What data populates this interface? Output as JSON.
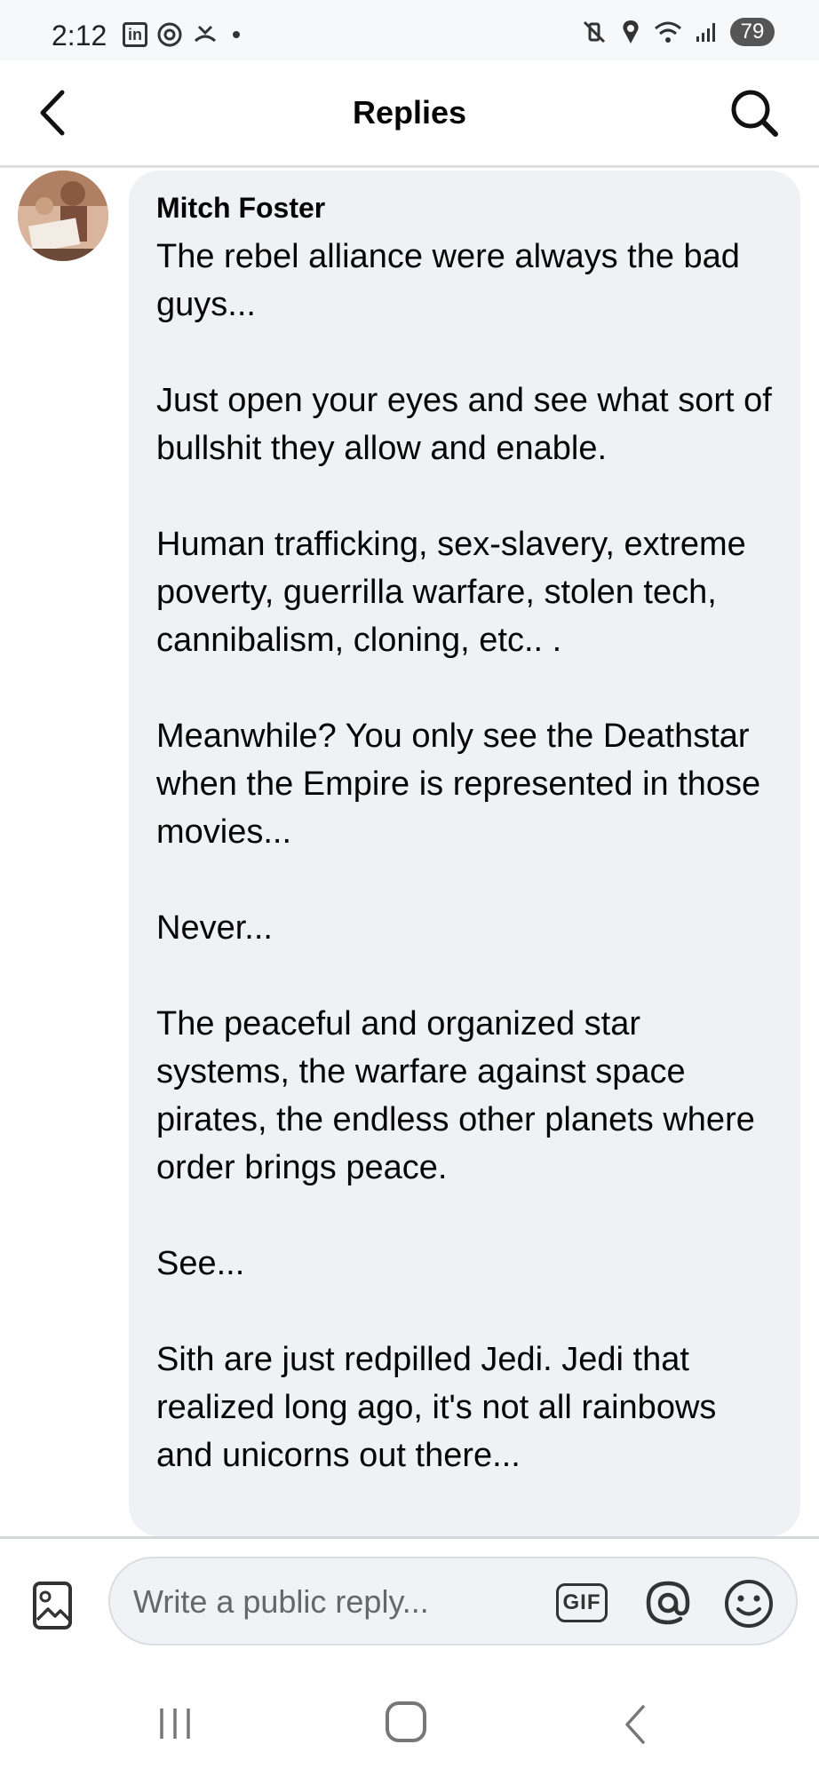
{
  "status_bar": {
    "time": "2:12",
    "left_icons": [
      "linkedin-icon",
      "threads-icon",
      "missed-call-icon",
      "dot-icon"
    ],
    "right_icons": [
      "vibrate-mute-icon",
      "location-icon",
      "wifi-icon",
      "signal-icon"
    ],
    "battery": "79"
  },
  "header": {
    "title": "Replies",
    "back_icon": "chevron-left-icon",
    "search_icon": "search-icon"
  },
  "comment": {
    "author": "Mitch Foster",
    "paragraphs": [
      "The rebel alliance were always the bad guys...",
      "Just open your eyes and see what sort of bullshit they allow and enable.",
      "Human trafficking, sex-slavery, extreme poverty, guerrilla warfare, stolen tech, cannibalism, cloning, etc.. .",
      "Meanwhile? You only see the Deathstar when the Empire is represented in those movies...",
      "Never...",
      "The peaceful and organized star systems, the warfare against space pirates, the endless other planets where order brings peace.",
      "See...",
      "Sith are just redpilled Jedi. Jedi that realized long ago, it's not all rainbows and unicorns out there..."
    ]
  },
  "composer": {
    "placeholder": "Write a public reply...",
    "gif_label": "GIF",
    "photo_icon": "photo-icon",
    "mention_icon": "at-icon",
    "emoji_icon": "emoji-icon"
  },
  "nav_bar": {
    "icons": [
      "recent-apps-icon",
      "home-icon",
      "back-icon"
    ]
  },
  "colors": {
    "bubble_bg": "#f0f1f4",
    "text": "#050505",
    "placeholder": "#65676b"
  }
}
